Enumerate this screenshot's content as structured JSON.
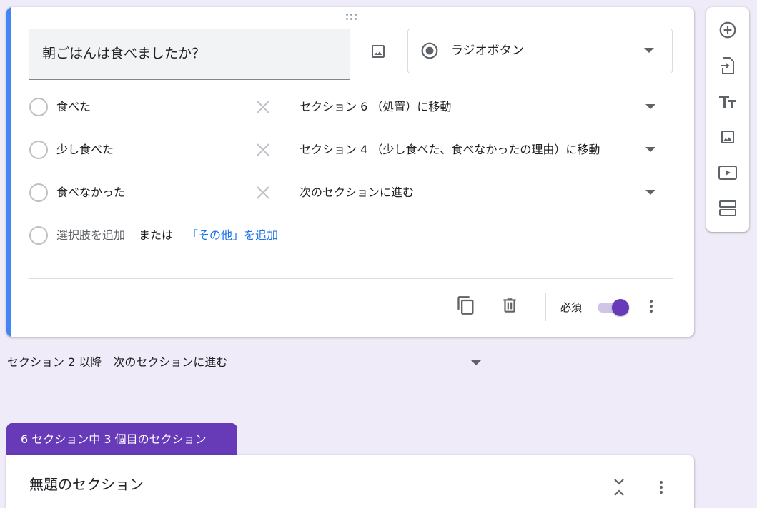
{
  "question": {
    "title": "朝ごはんは食べましたか？",
    "type_label": "ラジオボタン",
    "options": [
      {
        "label": "食べた",
        "route": "セクション 6 （処置）に移動"
      },
      {
        "label": "少し食べた",
        "route": "セクション 4 （少し食べた、食べなかったの理由）に移動"
      },
      {
        "label": "食べなかった",
        "route": "次のセクションに進む"
      }
    ],
    "add_option": {
      "label": "選択肢を追加",
      "or_text": "または",
      "add_other_label": "「その他」を追加"
    },
    "footer": {
      "required_label": "必須",
      "required_on": true
    }
  },
  "after_section": {
    "label": "セクション 2 以降",
    "value": "次のセクションに進む"
  },
  "next_section": {
    "tab_label": "6 セクション中 3 個目のセクション",
    "title": "無題のセクション"
  },
  "colors": {
    "accent": "#673ab7",
    "focus_bar": "#4285f4",
    "link": "#1a73e8",
    "background": "#f0ebf8"
  },
  "icons": {
    "toolbar": [
      "add-circle-icon",
      "import-question-icon",
      "title-text-icon",
      "image-icon",
      "video-icon",
      "section-icon"
    ],
    "footer": [
      "copy-icon",
      "delete-icon",
      "more-vert-icon"
    ]
  }
}
